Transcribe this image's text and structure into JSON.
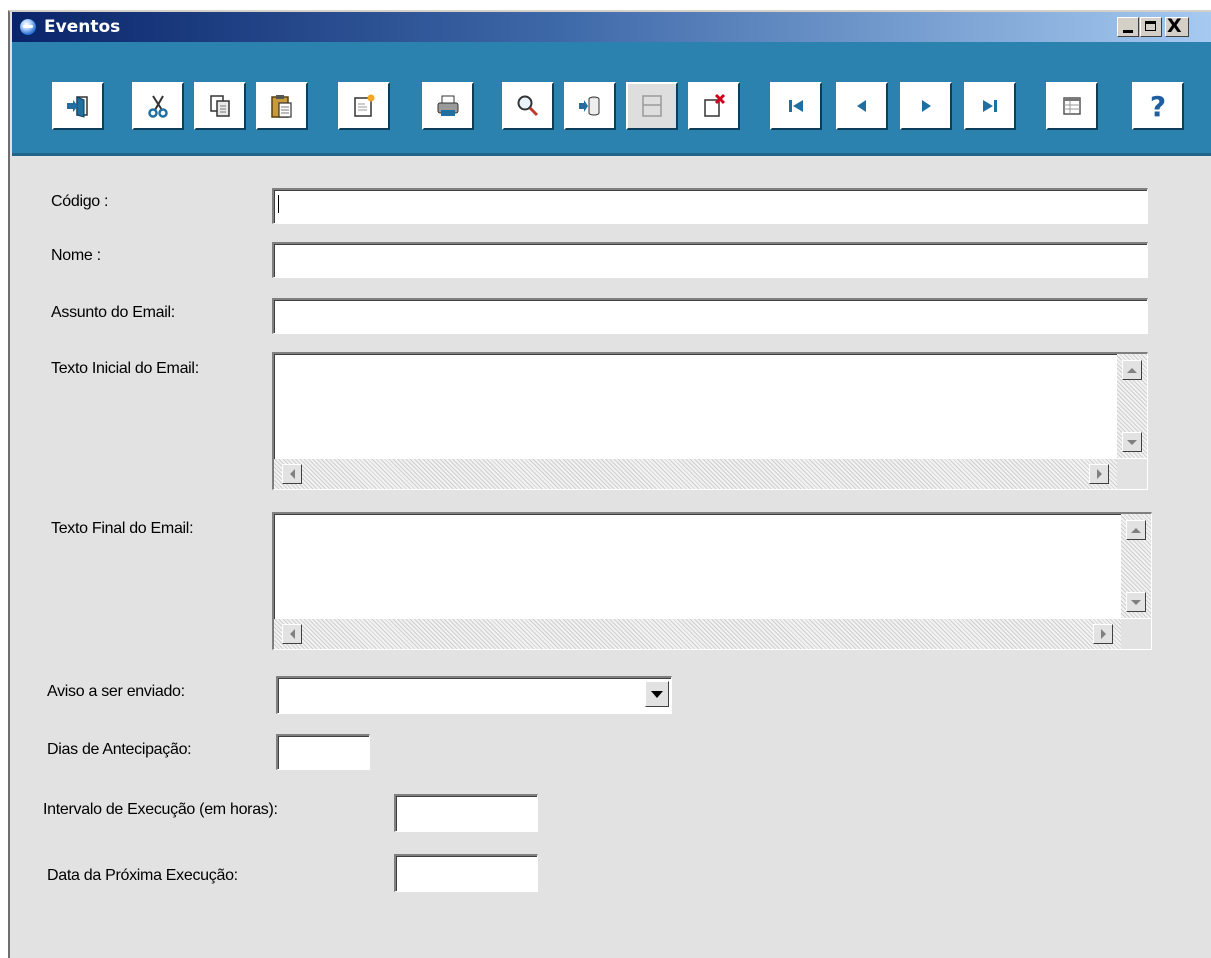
{
  "window": {
    "title": "Eventos",
    "controls": {
      "minimize": "_",
      "maximize": "□",
      "close": "X"
    }
  },
  "toolbar": {
    "buttons": [
      {
        "name": "exit",
        "icon": "exit-door-icon"
      },
      {
        "name": "cut",
        "icon": "scissors-icon"
      },
      {
        "name": "copy",
        "icon": "copy-icon"
      },
      {
        "name": "paste",
        "icon": "paste-icon"
      },
      {
        "name": "new",
        "icon": "new-record-icon"
      },
      {
        "name": "print",
        "icon": "printer-icon"
      },
      {
        "name": "search",
        "icon": "magnifier-icon"
      },
      {
        "name": "save",
        "icon": "save-database-icon"
      },
      {
        "name": "cancel-edit",
        "icon": "form-icon",
        "disabled": true
      },
      {
        "name": "delete",
        "icon": "delete-icon"
      },
      {
        "name": "first",
        "icon": "first-record-icon"
      },
      {
        "name": "previous",
        "icon": "previous-record-icon"
      },
      {
        "name": "next",
        "icon": "next-record-icon"
      },
      {
        "name": "last",
        "icon": "last-record-icon"
      },
      {
        "name": "grid-view",
        "icon": "grid-icon"
      },
      {
        "name": "help",
        "icon": "help-icon",
        "label": "?"
      }
    ]
  },
  "form": {
    "codigo": {
      "label": "Código :",
      "value": ""
    },
    "nome": {
      "label": "Nome :",
      "value": ""
    },
    "assunto": {
      "label": "Assunto do Email:",
      "value": ""
    },
    "texto_inicial": {
      "label": "Texto Inicial do Email:",
      "value": ""
    },
    "texto_final": {
      "label": "Texto Final do Email:",
      "value": ""
    },
    "aviso": {
      "label": "Aviso a ser enviado:",
      "value": ""
    },
    "dias": {
      "label": "Dias de Antecipação:",
      "value": ""
    },
    "intervalo": {
      "label": "Intervalo de Execução (em horas):",
      "value": ""
    },
    "data_proxima": {
      "label": "Data da Próxima Execução:",
      "value": ""
    }
  },
  "colors": {
    "title_gradient_start": "#0a246a",
    "title_gradient_end": "#a6caf0",
    "toolbar_bg": "#2b82ae",
    "window_bg": "#e2e2e2",
    "nav_arrow": "#1f6fa0"
  }
}
